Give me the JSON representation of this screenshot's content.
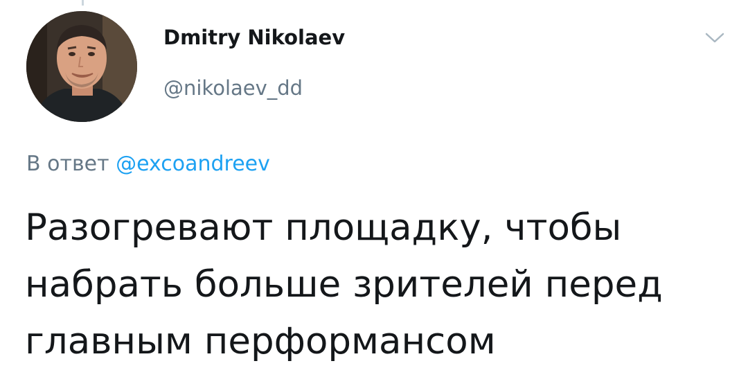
{
  "tweet": {
    "author": {
      "display_name": "Dmitry Nikolaev",
      "handle": "@nikolaev_dd",
      "avatar_icon": "profile-photo"
    },
    "menu_icon": "chevron-down-icon",
    "reply": {
      "prefix": "В ответ",
      "mention": "@excoandreev"
    },
    "text_lines": [
      "Разогревают площадку, чтобы",
      "набрать больше зрителей перед",
      "главным перформансом"
    ],
    "colors": {
      "text": "#14171a",
      "secondary": "#657786",
      "link": "#1da1f2"
    }
  }
}
